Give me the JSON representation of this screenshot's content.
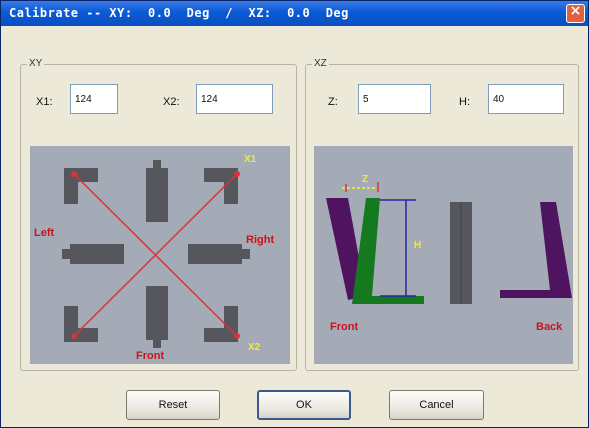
{
  "window": {
    "title": "Calibrate -- XY:  0.0  Deg  /  XZ:  0.0  Deg",
    "close_glyph": "×"
  },
  "xy_group": {
    "label": "XY",
    "x1_label": "X1:",
    "x1_value": "124",
    "x2_label": "X2:",
    "x2_value": "124",
    "diagram": {
      "label_left": "Left",
      "label_right": "Right",
      "label_front": "Front",
      "label_x1": "X1",
      "label_x2": "X2"
    }
  },
  "xz_group": {
    "label": "XZ",
    "z_label": "Z:",
    "z_value": "5",
    "h_label": "H:",
    "h_value": "40",
    "diagram": {
      "label_z": "Z",
      "label_h": "H",
      "label_front": "Front",
      "label_back": "Back"
    }
  },
  "buttons": {
    "reset": "Reset",
    "ok": "OK",
    "cancel": "Cancel"
  },
  "colors": {
    "title_bar": "#0a5ad6",
    "panel_bg": "#a4abb6",
    "part_gray": "#55575d",
    "line_red": "#d8343c",
    "label_red": "#c8141e",
    "label_yellow": "#f3e83a",
    "purple": "#4e1460",
    "green": "#157a1f",
    "blue": "#2426a0"
  }
}
